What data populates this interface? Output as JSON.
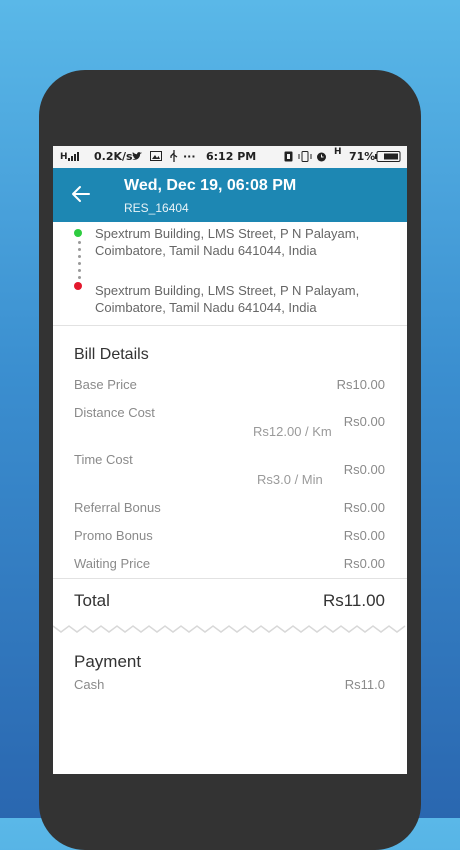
{
  "status_bar": {
    "signal": "H",
    "speed": "0.2K/s",
    "dots": "···",
    "time": "6:12 PM",
    "network": "H",
    "battery": "71%"
  },
  "header": {
    "title": "Wed, Dec 19, 06:08 PM",
    "subtitle": "RES_16404"
  },
  "route": {
    "pickup": "Spextrum Building, LMS Street, P N Palayam, Coimbatore, Tamil Nadu 641044, India",
    "drop": "Spextrum Building, LMS Street, P N Palayam, Coimbatore, Tamil Nadu 641044, India",
    "pickup_color": "#2ecc40",
    "drop_color": "#e3182d"
  },
  "bill": {
    "title": "Bill Details",
    "rows": [
      {
        "label": "Base Price",
        "value": "Rs10.00",
        "sub": ""
      },
      {
        "label": "Distance Cost",
        "value": "Rs0.00",
        "sub": "Rs12.00 / Km"
      },
      {
        "label": "Time Cost",
        "value": "Rs0.00",
        "sub": "Rs3.0 / Min"
      },
      {
        "label": "Referral Bonus",
        "value": "Rs0.00",
        "sub": ""
      },
      {
        "label": "Promo Bonus",
        "value": "Rs0.00",
        "sub": ""
      },
      {
        "label": "Waiting Price",
        "value": "Rs0.00",
        "sub": ""
      }
    ],
    "total_label": "Total",
    "total_value": "Rs11.00"
  },
  "payment": {
    "title": "Payment",
    "method": "Cash",
    "amount": "Rs11.0"
  },
  "colors": {
    "app_bar": "#1d87b3",
    "phone_frame": "#333333",
    "background_top": "#5ab8e8",
    "background_bottom": "#2a67b0"
  }
}
